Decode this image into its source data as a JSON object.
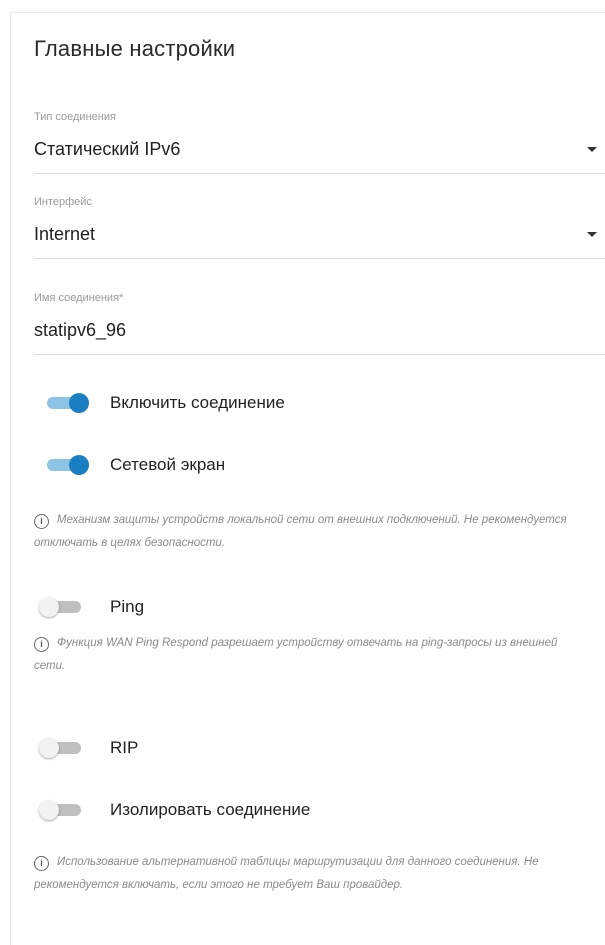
{
  "section": {
    "title": "Главные настройки"
  },
  "fields": {
    "connection_type": {
      "label": "Тип соединения",
      "value": "Статический IPv6"
    },
    "interface": {
      "label": "Интерфейс",
      "value": "Internet"
    },
    "connection_name": {
      "label": "Имя соединения*",
      "value": "statipv6_96"
    }
  },
  "toggles": {
    "enable_connection": {
      "label": "Включить соединение",
      "on": true
    },
    "firewall": {
      "label": "Сетевой экран",
      "on": true,
      "hint": "Механизм защиты устройств локальной сети от внешних подключений. Не рекомендуется отключать в целях безопасности."
    },
    "ping": {
      "label": "Ping",
      "on": false,
      "hint": "Функция WAN Ping Respond разрешает устройству отвечать на ping-запросы из внешней сети."
    },
    "rip": {
      "label": "RIP",
      "on": false
    },
    "isolate": {
      "label": "Изолировать соединение",
      "on": false,
      "hint": "Использование альтернативной таблицы маршрутизации для данного соединения. Не рекомендуется включать, если этого не требует Ваш провайдер."
    }
  },
  "colors": {
    "accent": "#1a7fc1",
    "track_on": "#8cc4e6",
    "track_off": "#bfbfbf"
  },
  "icons": {
    "dropdown": "caret-down-icon",
    "info": "info-icon"
  }
}
